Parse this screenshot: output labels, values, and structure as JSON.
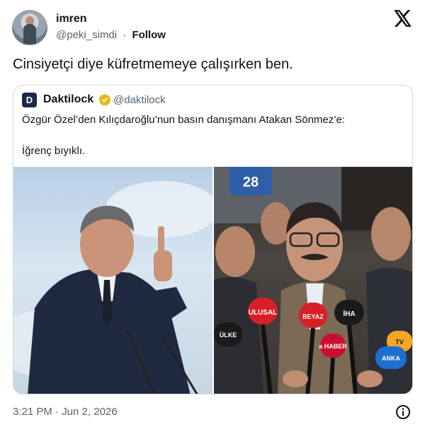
{
  "author": {
    "name": "imren",
    "handle": "@peki_simdi",
    "separator": "·",
    "follow_label": "Follow"
  },
  "tweet": {
    "text": "Cinsiyetçi diye küfretmemeye çalışırken ben.",
    "timestamp": "3:21 PM · Jun 2, 2026"
  },
  "quote": {
    "avatar_letter": "D",
    "name": "Daktilock",
    "handle": "@daktilock",
    "line1": "Özgür Özel’den Kılıçdaroğlu’nun basın danışmanı Atakan Sönmez’e:",
    "line2": "İğrenç bıyıklı."
  },
  "icons": {
    "x_logo": "x-logo-icon",
    "verified": "verified-badge-icon",
    "info": "info-icon"
  },
  "colors": {
    "text_primary": "#0f1419",
    "text_secondary": "#536471",
    "border": "#cfd9de",
    "verified_gold": "#e2b719"
  },
  "photo_left": {
    "label": "man pointing finger upward in front of sky"
  },
  "photo_right": {
    "sign_number": "28",
    "mic_labels": [
      "ULUSAL",
      "BEYAZ",
      "İHA",
      "a HABER",
      "ÜLKE",
      "TV",
      "ANKA"
    ]
  }
}
